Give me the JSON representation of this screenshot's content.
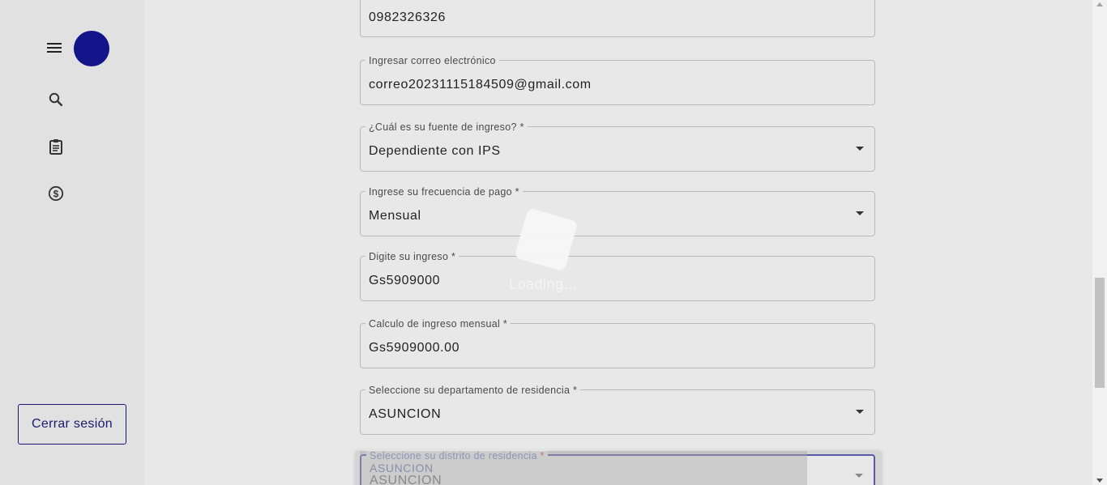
{
  "sidebar": {
    "menu_icon": "hamburger-menu-icon",
    "avatar_color": "#14148a",
    "nav": [
      {
        "icon": "search-icon"
      },
      {
        "icon": "clipboard-icon"
      },
      {
        "icon": "dollar-circle-icon"
      }
    ],
    "logout_label": "Cerrar sesión"
  },
  "form": {
    "phone": {
      "value": "0982326326"
    },
    "email": {
      "label": "Ingresar correo electrónico",
      "value": "correo20231115184509@gmail.com"
    },
    "income_source": {
      "label": "¿Cuál es su fuente de ingreso? *",
      "value": "Dependiente con IPS"
    },
    "pay_frequency": {
      "label": "Ingrese su frecuencia de pago *",
      "value": "Mensual"
    },
    "income": {
      "label": "Digite su ingreso *",
      "value": "Gs5909000"
    },
    "monthly_income": {
      "label": "Calculo de ingreso mensual *",
      "value": "Gs5909000.00"
    },
    "department": {
      "label": "Seleccione su departamento de residencia *",
      "value": "ASUNCION"
    },
    "district": {
      "label": "Seleccione su distrito de residencia",
      "required_mark": "*",
      "value": "ASUNCION",
      "value_ghost": "ASUNCION"
    }
  },
  "loading": {
    "text": "Loading..."
  },
  "colors": {
    "accent": "#1a1a6e",
    "focus": "#5a5aa8"
  }
}
